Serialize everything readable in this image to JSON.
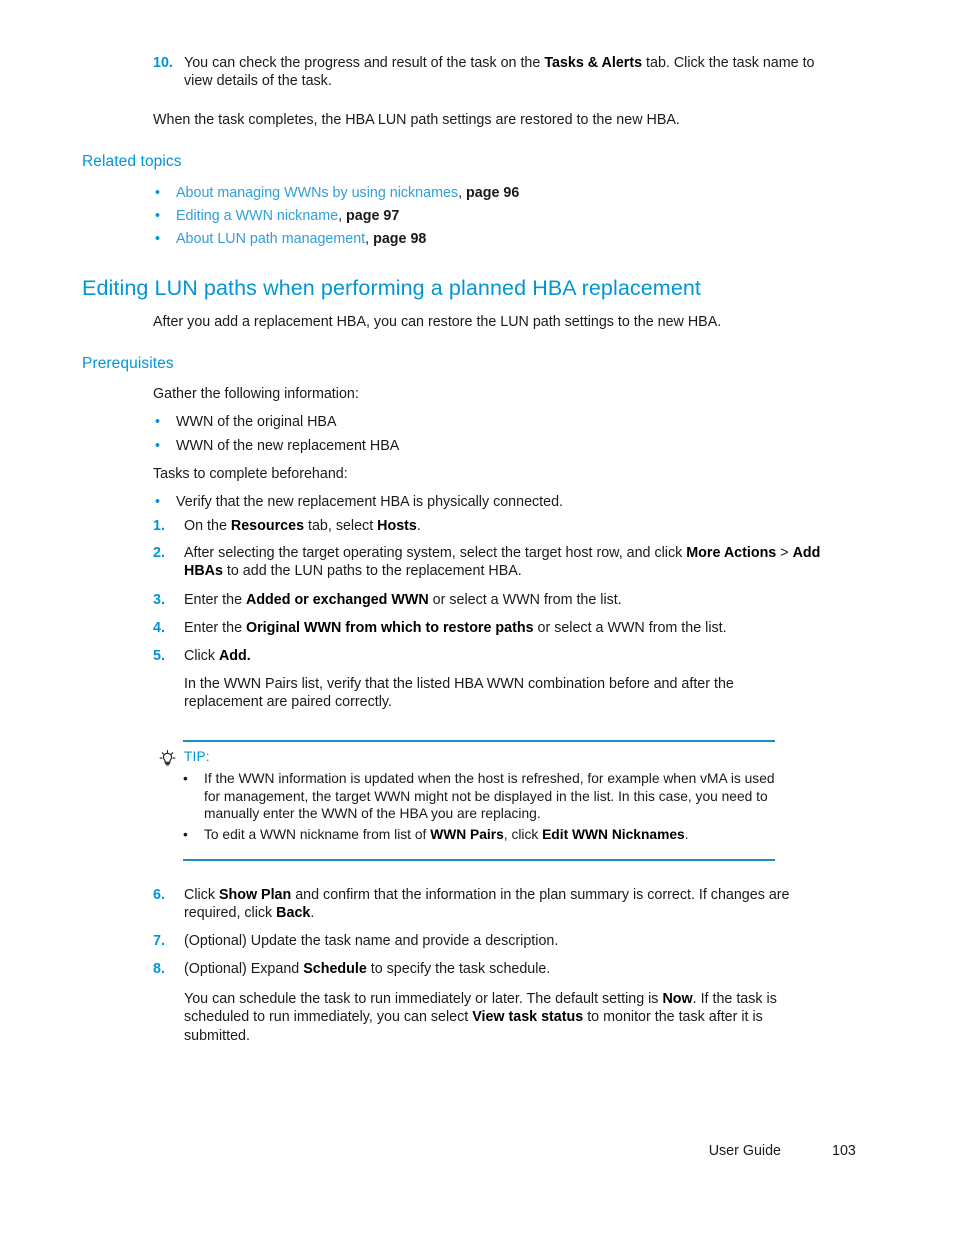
{
  "document": {
    "footer": {
      "guide_label": "User Guide",
      "page_number": "103"
    },
    "colors": {
      "heading_blue": "#0096d6",
      "link_blue": "#2f9fd8",
      "rule_blue": "#1a8ec4",
      "body_black": "#1a1a1a"
    }
  },
  "top_step": {
    "number": "10.",
    "text_before_bold": "You can check the progress and result of the task on the ",
    "bold": "Tasks & Alerts",
    "text_after_bold": " tab. Click the task name to view details of the task."
  },
  "top_paragraph": {
    "text": "When the task completes, the HBA LUN path settings are restored to the new HBA."
  },
  "related_topics": {
    "heading": "Related topics",
    "items": [
      {
        "bullet": "•",
        "link": "About managing WWNs by using nicknames",
        "comma": ", ",
        "pageref": "page 96"
      },
      {
        "bullet": "•",
        "link": "Editing a WWN nickname",
        "comma": ", ",
        "pageref": "page 97"
      },
      {
        "bullet": "•",
        "link": "About LUN path management",
        "comma": ", ",
        "pageref": "page 98"
      }
    ]
  },
  "section": {
    "heading": "Editing LUN paths when performing a planned HBA replacement",
    "intro": "After you add a replacement HBA, you can restore the LUN path settings to the new HBA."
  },
  "prerequisites": {
    "heading": "Prerequisites",
    "gather_lead": "Gather the following information:",
    "gather_items": [
      {
        "bullet": "•",
        "text": "WWN of the original HBA"
      },
      {
        "bullet": "•",
        "text": "WWN of the new replacement HBA"
      }
    ],
    "tasks_lead": "Tasks to complete beforehand:",
    "tasks_items": [
      {
        "bullet": "•",
        "text": "Verify that the new replacement HBA is physically connected."
      }
    ]
  },
  "steps": {
    "s1": {
      "number": "1.",
      "p1": "On the ",
      "b1": "Resources",
      "p2": " tab, select ",
      "b2": "Hosts",
      "p3": "."
    },
    "s2": {
      "number": "2.",
      "p1": "After selecting the target operating system, select the target host row, and click ",
      "b1": "More Actions",
      "p2": " > ",
      "b2": "Add HBAs",
      "p3": " to add the LUN paths to the replacement HBA."
    },
    "s3": {
      "number": "3.",
      "p1": "Enter the ",
      "b1": "Added or exchanged WWN",
      "p2": " or select a WWN from the list."
    },
    "s4": {
      "number": "4.",
      "p1": "Enter the ",
      "b1": "Original WWN from which to restore paths",
      "p2": " or select a WWN from the list."
    },
    "s5": {
      "number": "5.",
      "p1": "Click ",
      "b1": "Add.",
      "p2": ""
    },
    "s5_note": "In the WWN Pairs list, verify that the listed HBA WWN combination before and after the replacement are paired correctly.",
    "s6": {
      "number": "6.",
      "p1": "Click ",
      "b1": "Show Plan",
      "p2": " and confirm that the information in the plan summary is correct. If changes are required, click ",
      "b2": "Back",
      "p3": "."
    },
    "s7": {
      "number": "7.",
      "p1": "(Optional) Update the task name and provide a description."
    },
    "s8": {
      "number": "8.",
      "p1": "(Optional) Expand ",
      "b1": "Schedule",
      "p2": " to specify the task schedule."
    },
    "s8_note": {
      "p1": "You can schedule the task to run immediately or later. The default setting is ",
      "b1": "Now",
      "p2": ". If the task is scheduled to run immediately, you can select ",
      "b2": "View task status",
      "p3": " to monitor the task after it is submitted."
    }
  },
  "tip": {
    "icon": "lightbulb-icon",
    "label": "TIP:",
    "items": [
      {
        "bullet": "•",
        "text": "If the WWN information is updated when the host is refreshed, for example when vMA is used for management, the target WWN might not be displayed in the list. In this case, you need to manually enter the WWN of the HBA you are replacing."
      }
    ],
    "item2": {
      "bullet": "•",
      "p1": "To edit a WWN nickname from list of ",
      "b1": "WWN Pairs",
      "p2": ", click ",
      "b2": "Edit WWN Nicknames",
      "p3": "."
    }
  }
}
